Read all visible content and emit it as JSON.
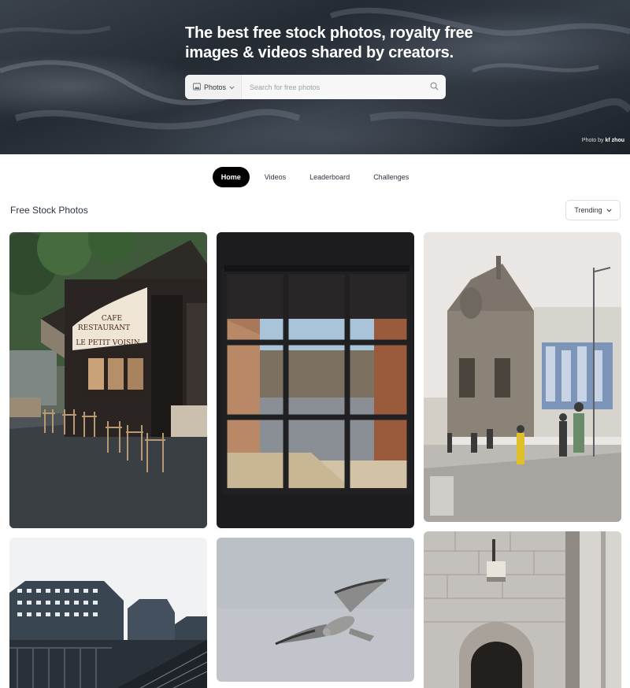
{
  "hero": {
    "title_line1": "The best free stock photos, royalty free",
    "title_line2": "images & videos shared by creators.",
    "search": {
      "type_label": "Photos",
      "placeholder": "Search for free photos"
    },
    "credit_prefix": "Photo by",
    "credit_author": "kf zhou"
  },
  "tabs": [
    {
      "label": "Home",
      "active": true
    },
    {
      "label": "Videos",
      "active": false
    },
    {
      "label": "Leaderboard",
      "active": false
    },
    {
      "label": "Challenges",
      "active": false
    }
  ],
  "section": {
    "title": "Free Stock Photos",
    "sort_label": "Trending"
  },
  "photos": {
    "cafe": {
      "sign_line1": "CAFE",
      "sign_line2": "RESTAURANT",
      "sign_line3": "LE PETIT VOISIN"
    }
  },
  "colors": {
    "accent_active_tab": "#000000",
    "text": "#2c343e"
  },
  "icons": [
    "image-icon",
    "chevron-down-icon",
    "search-icon"
  ]
}
